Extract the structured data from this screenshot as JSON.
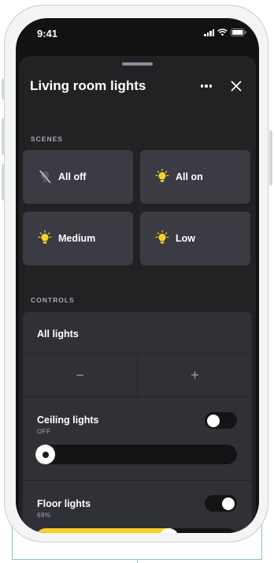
{
  "status_bar": {
    "time": "9:41"
  },
  "sheet": {
    "title": "Living room lights"
  },
  "scenes": {
    "label": "SCENES",
    "items": [
      {
        "label": "All off",
        "icon": "bulb-off-icon"
      },
      {
        "label": "All on",
        "icon": "bulb-on-icon"
      },
      {
        "label": "Medium",
        "icon": "bulb-on-icon"
      },
      {
        "label": "Low",
        "icon": "bulb-on-icon"
      }
    ]
  },
  "controls": {
    "label": "CONTROLS",
    "all_lights": {
      "label": "All lights",
      "decrease_symbol": "−",
      "increase_symbol": "+"
    },
    "lights": [
      {
        "name": "Ceiling lights",
        "status": "OFF",
        "on": false,
        "level": 0
      },
      {
        "name": "Floor lights",
        "status": "68%",
        "on": true,
        "level": 0.68
      }
    ]
  },
  "colors": {
    "accent": "#f3d328",
    "sheet_bg": "#222225",
    "tile_bg": "#3b3c43",
    "screen_bg": "#121212"
  }
}
